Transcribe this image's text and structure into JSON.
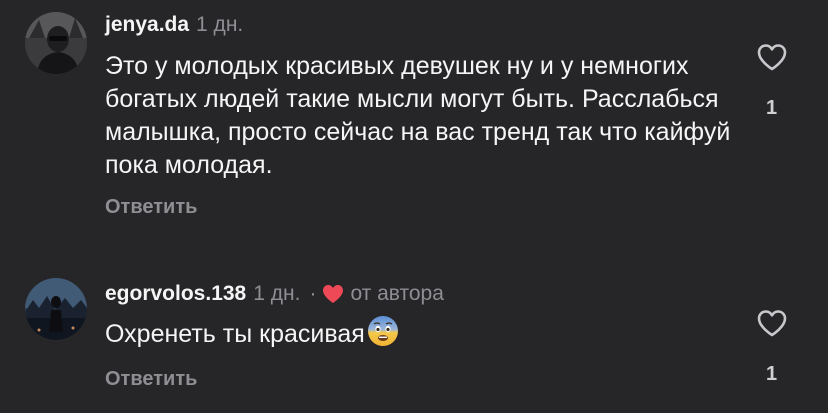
{
  "comments": [
    {
      "username": "jenya.da",
      "time": "1 дн.",
      "text": "Это у молодых красивых девушек ну и у немногих богатых людей такие мысли могут быть. Расслабься малышка, просто сейчас на вас тренд так что кайфуй пока молодая.",
      "reply_label": "Ответить",
      "like_count": "1"
    },
    {
      "username": "egorvolos.138",
      "time": "1 дн.",
      "separator": "·",
      "author_note": "от автора",
      "text": "Охренеть ты красивая",
      "emoji": "fearful-face-emoji",
      "reply_label": "Ответить",
      "like_count": "1"
    }
  ],
  "colors": {
    "background": "#262628",
    "primary_text": "#f5f5f5",
    "secondary_text": "#8e8e93",
    "author_heart": "#ed4956"
  }
}
